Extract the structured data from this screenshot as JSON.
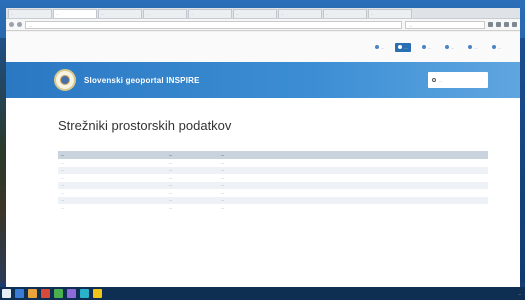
{
  "browser": {
    "tabs": [
      {
        "label": "...",
        "active": false
      },
      {
        "label": "...",
        "active": true
      },
      {
        "label": "...",
        "active": false
      },
      {
        "label": "...",
        "active": false
      },
      {
        "label": "...",
        "active": false
      },
      {
        "label": "...",
        "active": false
      },
      {
        "label": "...",
        "active": false
      },
      {
        "label": "...",
        "active": false
      },
      {
        "label": "...",
        "active": false
      }
    ],
    "url": "...",
    "search_placeholder": "..."
  },
  "topnav": {
    "items": [
      {
        "label": "...",
        "active": false
      },
      {
        "label": "...",
        "active": true
      },
      {
        "label": "...",
        "active": false
      },
      {
        "label": "...",
        "active": false
      },
      {
        "label": "...",
        "active": false
      },
      {
        "label": "...",
        "active": false
      }
    ]
  },
  "banner": {
    "site_title": "Slovenski geoportal INSPIRE",
    "search_placeholder": "..."
  },
  "main": {
    "page_title": "Strežniki prostorskih podatkov",
    "table": {
      "headers": [
        "...",
        "...",
        "..."
      ],
      "rows": [
        [
          "...",
          "...",
          "..."
        ],
        [
          "...",
          "...",
          "..."
        ],
        [
          "...",
          "...",
          "..."
        ],
        [
          "...",
          "...",
          "..."
        ],
        [
          "...",
          "...",
          "..."
        ],
        [
          "...",
          "...",
          "..."
        ],
        [
          "...",
          "...",
          "..."
        ]
      ]
    }
  },
  "colors": {
    "banner": "#2b78c2",
    "accent": "#2a6eb3",
    "table_header": "#c9d3de"
  }
}
